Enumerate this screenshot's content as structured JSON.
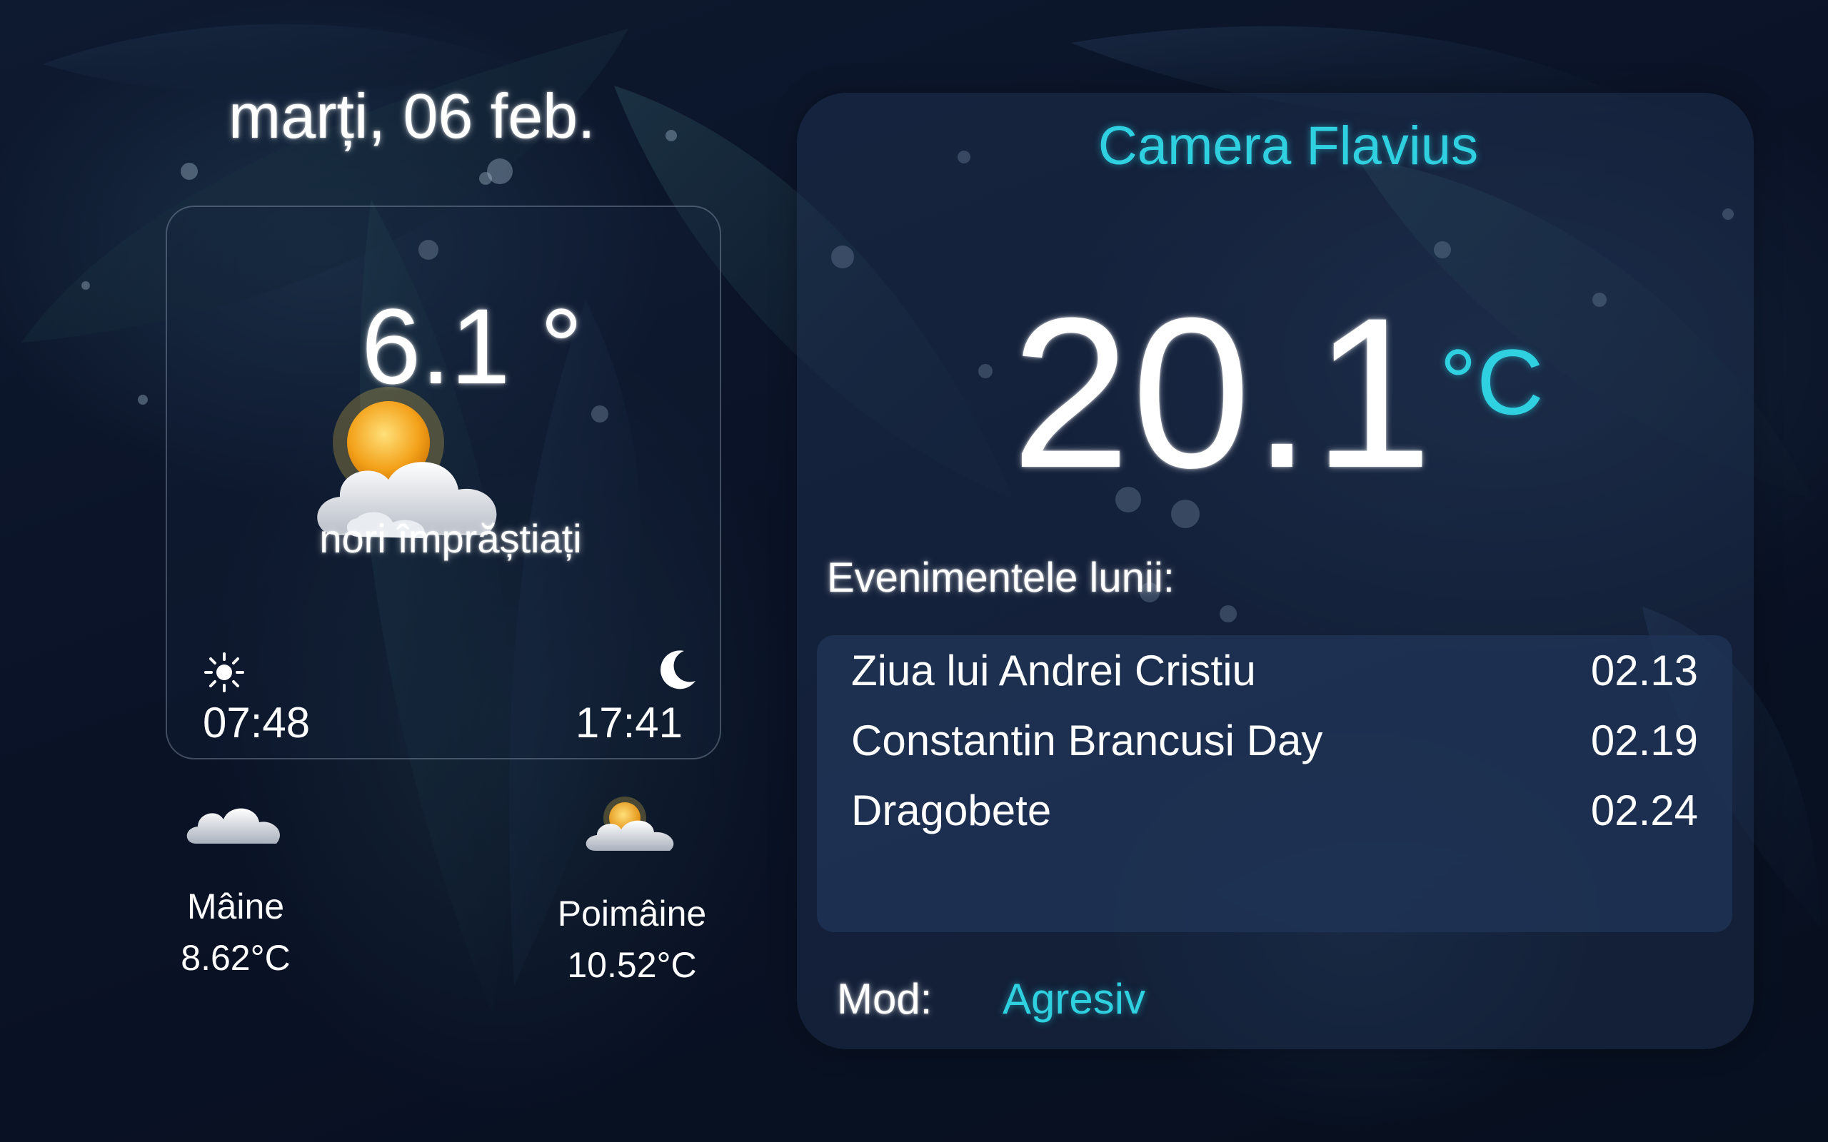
{
  "date": "marți, 06 feb.",
  "weather": {
    "temperature": "6.1 °",
    "condition": "nori împrăștiați",
    "icon": "partly-cloudy-icon",
    "sunrise": "07:48",
    "sunset": "17:41"
  },
  "forecast": [
    {
      "day": "Mâine",
      "temp": "8.62°C",
      "icon": "cloud-icon"
    },
    {
      "day": "Poimâine",
      "temp": "10.52°C",
      "icon": "partly-cloudy-icon"
    }
  ],
  "room": {
    "name": "Camera Flavius",
    "temperature": "20.1",
    "unit": "°C"
  },
  "events": {
    "heading": "Evenimentele lunii:",
    "items": [
      {
        "name": "Ziua lui Andrei Cristiu",
        "date": "02.13"
      },
      {
        "name": "Constantin Brancusi Day",
        "date": "02.19"
      },
      {
        "name": "Dragobete",
        "date": "02.24"
      }
    ]
  },
  "mode": {
    "label": "Mod:",
    "value": "Agresiv"
  },
  "colors": {
    "accent": "#2fd0e0",
    "panel": "#24375a",
    "background": "#0a1226"
  }
}
